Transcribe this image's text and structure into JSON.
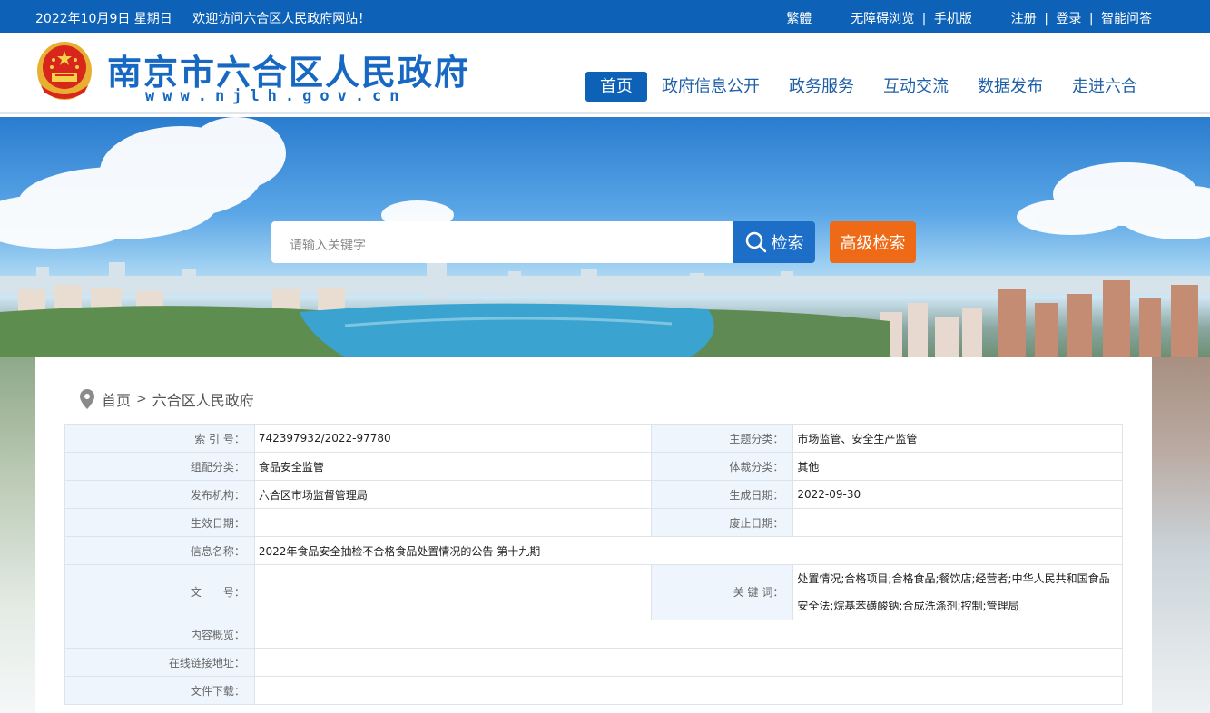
{
  "topbar": {
    "date": "2022年10月9日 星期日",
    "welcome": "欢迎访问六合区人民政府网站！",
    "traditional": "繁體",
    "accessible": "无障碍浏览",
    "mobile": "手机版",
    "register": "注册",
    "login": "登录",
    "smart_qa": "智能问答",
    "separator": "|"
  },
  "header": {
    "site_title": "南京市六合区人民政府",
    "site_url": "www.njlh.gov.cn",
    "nav": [
      {
        "label": "首页",
        "active": true
      },
      {
        "label": "政府信息公开",
        "active": false
      },
      {
        "label": "政务服务",
        "active": false
      },
      {
        "label": "互动交流",
        "active": false
      },
      {
        "label": "数据发布",
        "active": false
      },
      {
        "label": "走进六合",
        "active": false
      }
    ]
  },
  "search": {
    "placeholder": "请输入关键字",
    "button_label": "检索",
    "advanced_label": "高级检索"
  },
  "breadcrumb": {
    "home": "首页",
    "arrow": ">",
    "current": "六合区人民政府"
  },
  "info": {
    "index_label": "索 引 号：",
    "index_value": "742397932/2022-97780",
    "topic_label": "主题分类：",
    "topic_value": "市场监管、安全生产监管",
    "group_label": "组配分类：",
    "group_value": "食品安全监管",
    "genre_label": "体裁分类：",
    "genre_value": "其他",
    "publisher_label": "发布机构：",
    "publisher_value": "六合区市场监督管理局",
    "created_label": "生成日期：",
    "created_value": "2022-09-30",
    "effective_label": "生效日期：",
    "effective_value": "",
    "expire_label": "废止日期：",
    "expire_value": "",
    "name_label": "信息名称：",
    "name_value": "2022年食品安全抽检不合格食品处置情况的公告 第十九期",
    "docno_label": "文　　号：",
    "docno_value": "",
    "keywords_label": "关 键 词：",
    "keywords_value": "处置情况;合格项目;合格食品;餐饮店;经营者;中华人民共和国食品安全法;烷基苯磺酸钠;合成洗涤剂;控制;管理局",
    "summary_label": "内容概览：",
    "summary_value": "",
    "link_label": "在线链接地址：",
    "link_value": "",
    "download_label": "文件下载：",
    "download_value": ""
  },
  "colors": {
    "primary": "#0d62b8",
    "accent_orange": "#ee6a16",
    "label_bg": "#eef5fd"
  },
  "icons": {
    "search": "magnifier-icon",
    "location": "map-pin-icon",
    "emblem": "national-emblem-icon"
  }
}
